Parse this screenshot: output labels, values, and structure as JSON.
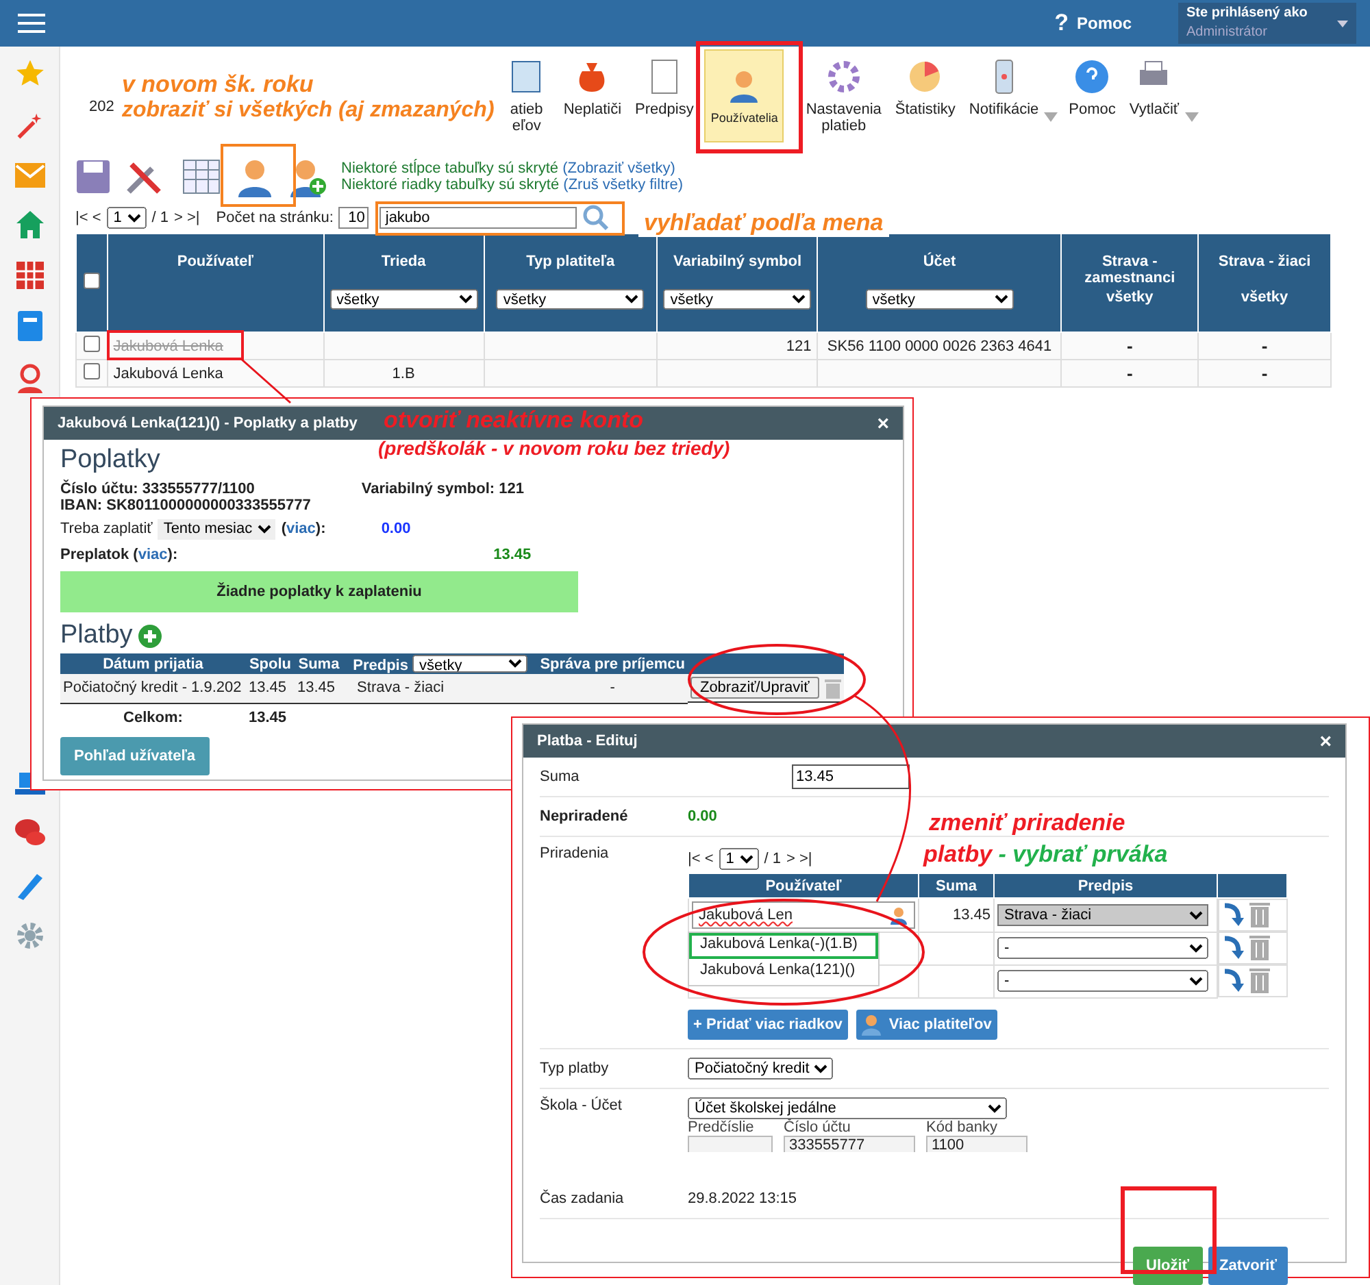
{
  "topbar": {
    "help_icon": "?",
    "help": "Pomoc",
    "login_label": "Ste prihlásený ako",
    "login_value": "Administrátor"
  },
  "toolbar": [
    {
      "label": [
        "202"
      ],
      "selected": false,
      "dropdown": false
    },
    {
      "label": [
        "atieb",
        "eľov"
      ],
      "selected": false,
      "dropdown": false
    },
    {
      "label": [
        "Neplatiči"
      ],
      "selected": false,
      "dropdown": false
    },
    {
      "label": [
        "Predpisy"
      ],
      "selected": false,
      "dropdown": false
    },
    {
      "label": [
        "Používatelia"
      ],
      "selected": true,
      "dropdown": false
    },
    {
      "label": [
        "Nastavenia",
        "platieb"
      ],
      "selected": false,
      "dropdown": false
    },
    {
      "label": [
        "Štatistiky"
      ],
      "selected": false,
      "dropdown": false
    },
    {
      "label": [
        "Notifikácie"
      ],
      "selected": false,
      "dropdown": true
    },
    {
      "label": [
        "Pomoc"
      ],
      "selected": false,
      "dropdown": false
    },
    {
      "label": [
        "Vytlačiť"
      ],
      "selected": false,
      "dropdown": true
    }
  ],
  "notes": [
    {
      "text": "Niektoré stĺpce tabuľky sú skryté",
      "link": "(Zobraziť všetky)"
    },
    {
      "text": "Niektoré riadky tabuľky sú skryté",
      "link": "(Zruš všetky filtre)"
    }
  ],
  "pager": {
    "first": "|< <",
    "page": "1",
    "of": "/ 1",
    "last": "> >|",
    "per_page_label": "Počet na stránku:",
    "per_page": "10",
    "search": "jakubo"
  },
  "table": {
    "select_all_checked": false,
    "columns": [
      {
        "label": "Používateľ"
      },
      {
        "label": "Trieda",
        "filter": "všetky"
      },
      {
        "label": "Typ platiteľa",
        "filter": "všetky"
      },
      {
        "label": "Variabilný symbol",
        "filter": "všetky"
      },
      {
        "label": "Účet",
        "filter": "všetky"
      },
      {
        "label": "Strava - zamestnanci",
        "filter": "všetky"
      },
      {
        "label": "Strava - žiaci",
        "filter": "všetky"
      }
    ],
    "rows": [
      {
        "deleted": true,
        "checked": false,
        "cells": [
          "Jakubová Lenka",
          "",
          "",
          "121",
          "SK56 1100 0000 0026 2363 4641",
          "-",
          "-"
        ]
      },
      {
        "deleted": false,
        "checked": false,
        "cells": [
          "Jakubová Lenka",
          "1.B",
          "",
          "",
          "",
          "-",
          "-"
        ]
      }
    ]
  },
  "fees_dialog": {
    "title": "Jakubová Lenka(121)() - Poplatky a platby",
    "close": "×",
    "heading": "Poplatky",
    "account": "Číslo účtu: 333555777/1100",
    "vs": "Variabilný symbol: 121",
    "iban": "IBAN: SK8011000000000333555777",
    "due_label": "Treba zaplatiť",
    "due_period": "Tento mesiac",
    "due_more": {
      "before": "(",
      "link": "viac",
      "after": "):"
    },
    "due_value": "0.00",
    "overpay_label": "Preplatok",
    "overpay": {
      "before": "(",
      "link": "viac",
      "after": "):"
    },
    "overpay_value": "13.45",
    "no_fees": "Žiadne poplatky k zaplateniu",
    "payments_heading": "Platby",
    "columns": [
      "Dátum prijatia",
      "Spolu",
      "Suma",
      "Predpis",
      "Správa pre príjemcu"
    ],
    "filter": "všetky",
    "rows": [
      {
        "cells": [
          "Počiatočný kredit - 1.9.202",
          "13.45",
          "13.45",
          "Strava - žiaci",
          "-"
        ],
        "action": "Zobraziť/Upraviť"
      }
    ],
    "total_label": "Celkom:",
    "total": "13.45",
    "user_view": "Pohľad užívateľa"
  },
  "payment_dialog": {
    "title": "Platba - Edituj",
    "close": "×",
    "sum_label": "Suma",
    "sum": "13.45",
    "unassigned_label": "Nepriradené",
    "unassigned": "0.00",
    "assign_label": "Priradenia",
    "pager": {
      "first": "|< <",
      "page": "1",
      "of": "/ 1",
      "last": "> >|"
    },
    "columns": [
      "Používateľ",
      "Suma",
      "Predpis"
    ],
    "rows": [
      {
        "user": "Jakubová Len",
        "sum": "13.45",
        "item": "Strava - žiaci",
        "highlighted": true
      },
      {
        "user": "",
        "sum": "",
        "item": "-",
        "highlighted": false
      },
      {
        "user": "",
        "sum": "",
        "item": "-",
        "highlighted": false
      }
    ],
    "suggestions": [
      {
        "text": "Jakubová Lenka(-)(1.B)",
        "selected": true
      },
      {
        "text": "Jakubová Lenka(121)()",
        "selected": false
      }
    ],
    "add_rows": "+ Pridať viac riadkov",
    "more_payers": "Viac platiteľov",
    "type_label": "Typ platby",
    "type": "Počiatočný kredit",
    "school_label": "Škola - Účet",
    "school_account": "Účet školskej jedálne",
    "prefix_label": "Predčíslie",
    "number_label": "Číslo účtu",
    "number": "333555777",
    "bank_label": "Kód banky",
    "bank": "1100",
    "time_label": "Čas zadania",
    "time": "29.8.2022 13:15",
    "save": "Uložiť",
    "close_button": "Zatvoriť"
  },
  "annotations": {
    "new_year": "v novom šk. roku",
    "show_all": "zobraziť si všetkých (aj zmazaných)",
    "search_by_name": "vyhľadať podľa mena",
    "open_inactive": "otvoriť neaktívne konto",
    "preschool": "(predškolák - v novom roku bez triedy)",
    "change_assign": "zmeniť priradenie",
    "payment": "platby",
    "pick_first": "- vybrať prváka"
  }
}
